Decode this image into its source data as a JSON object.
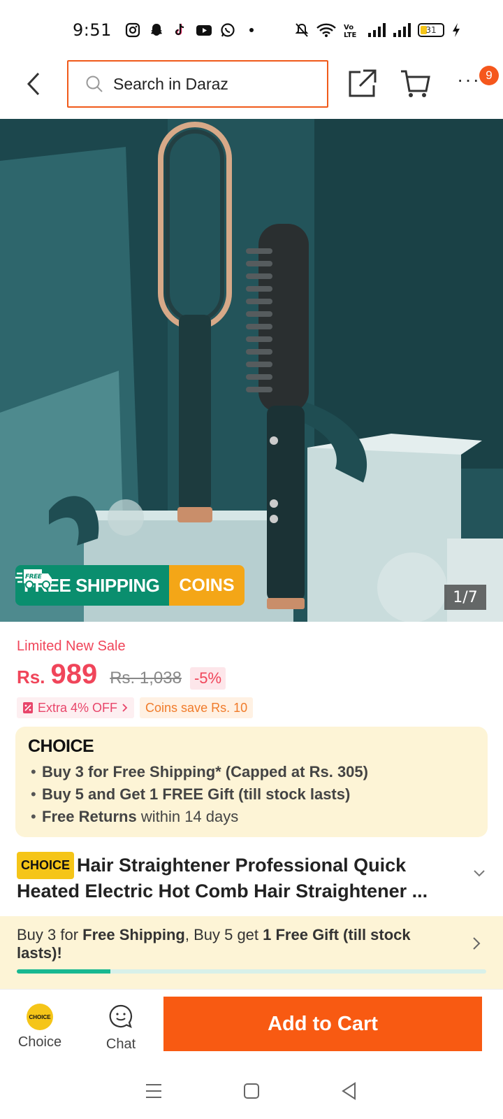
{
  "status_bar": {
    "time": "9:51",
    "battery": "31",
    "app_icons": [
      "instagram-icon",
      "snapchat-icon",
      "tiktok-icon",
      "youtube-icon",
      "whatsapp-icon",
      "dot-icon"
    ],
    "system_icons": [
      "mute-icon",
      "wifi-icon",
      "volte-icon",
      "signal-icon",
      "signal-icon",
      "battery-icon",
      "charging-icon"
    ]
  },
  "header": {
    "search_placeholder": "Search in Daraz",
    "cart_badge": "9",
    "more_label": "···"
  },
  "gallery": {
    "counter": "1/7",
    "free_shipping": "FREE SHIPPING",
    "free_tag": "FREE",
    "coins": "COINS"
  },
  "pricing": {
    "sale_label": "Limited New Sale",
    "currency": "Rs.",
    "price": "989",
    "original_price": "Rs. 1,038",
    "discount": "-5%",
    "extra_off": "Extra 4% OFF",
    "coins_save": "Coins save Rs. 10"
  },
  "choice": {
    "logo": "CHOICE",
    "items": [
      {
        "bold": "Buy 3 for  Free Shipping* (Capped at Rs. 305)",
        "rest": ""
      },
      {
        "bold": "Buy 5 and Get 1 FREE Gift (till stock lasts)",
        "rest": ""
      },
      {
        "bold": "Free Returns",
        "rest": " within 14 days"
      }
    ]
  },
  "product": {
    "chip": "CHOICE",
    "title": "Hair Straightener Professional Quick Heated Electric Hot Comb Hair Straightener ..."
  },
  "bundle": {
    "p1": "Buy 3 for ",
    "b1": "Free Shipping",
    "p2": ", Buy 5 get ",
    "b2": "1 Free Gift (till stock lasts)",
    "p3": "!",
    "progress": 0.2
  },
  "actions": {
    "choice_label": "Choice",
    "choice_badge": "CHOICE",
    "chat_label": "Chat",
    "add_to_cart": "Add to Cart"
  },
  "colors": {
    "brand_orange": "#f85a12",
    "price_red": "#f0455a",
    "choice_yellow": "#f5c518",
    "shipping_green": "#0a8e6e"
  }
}
